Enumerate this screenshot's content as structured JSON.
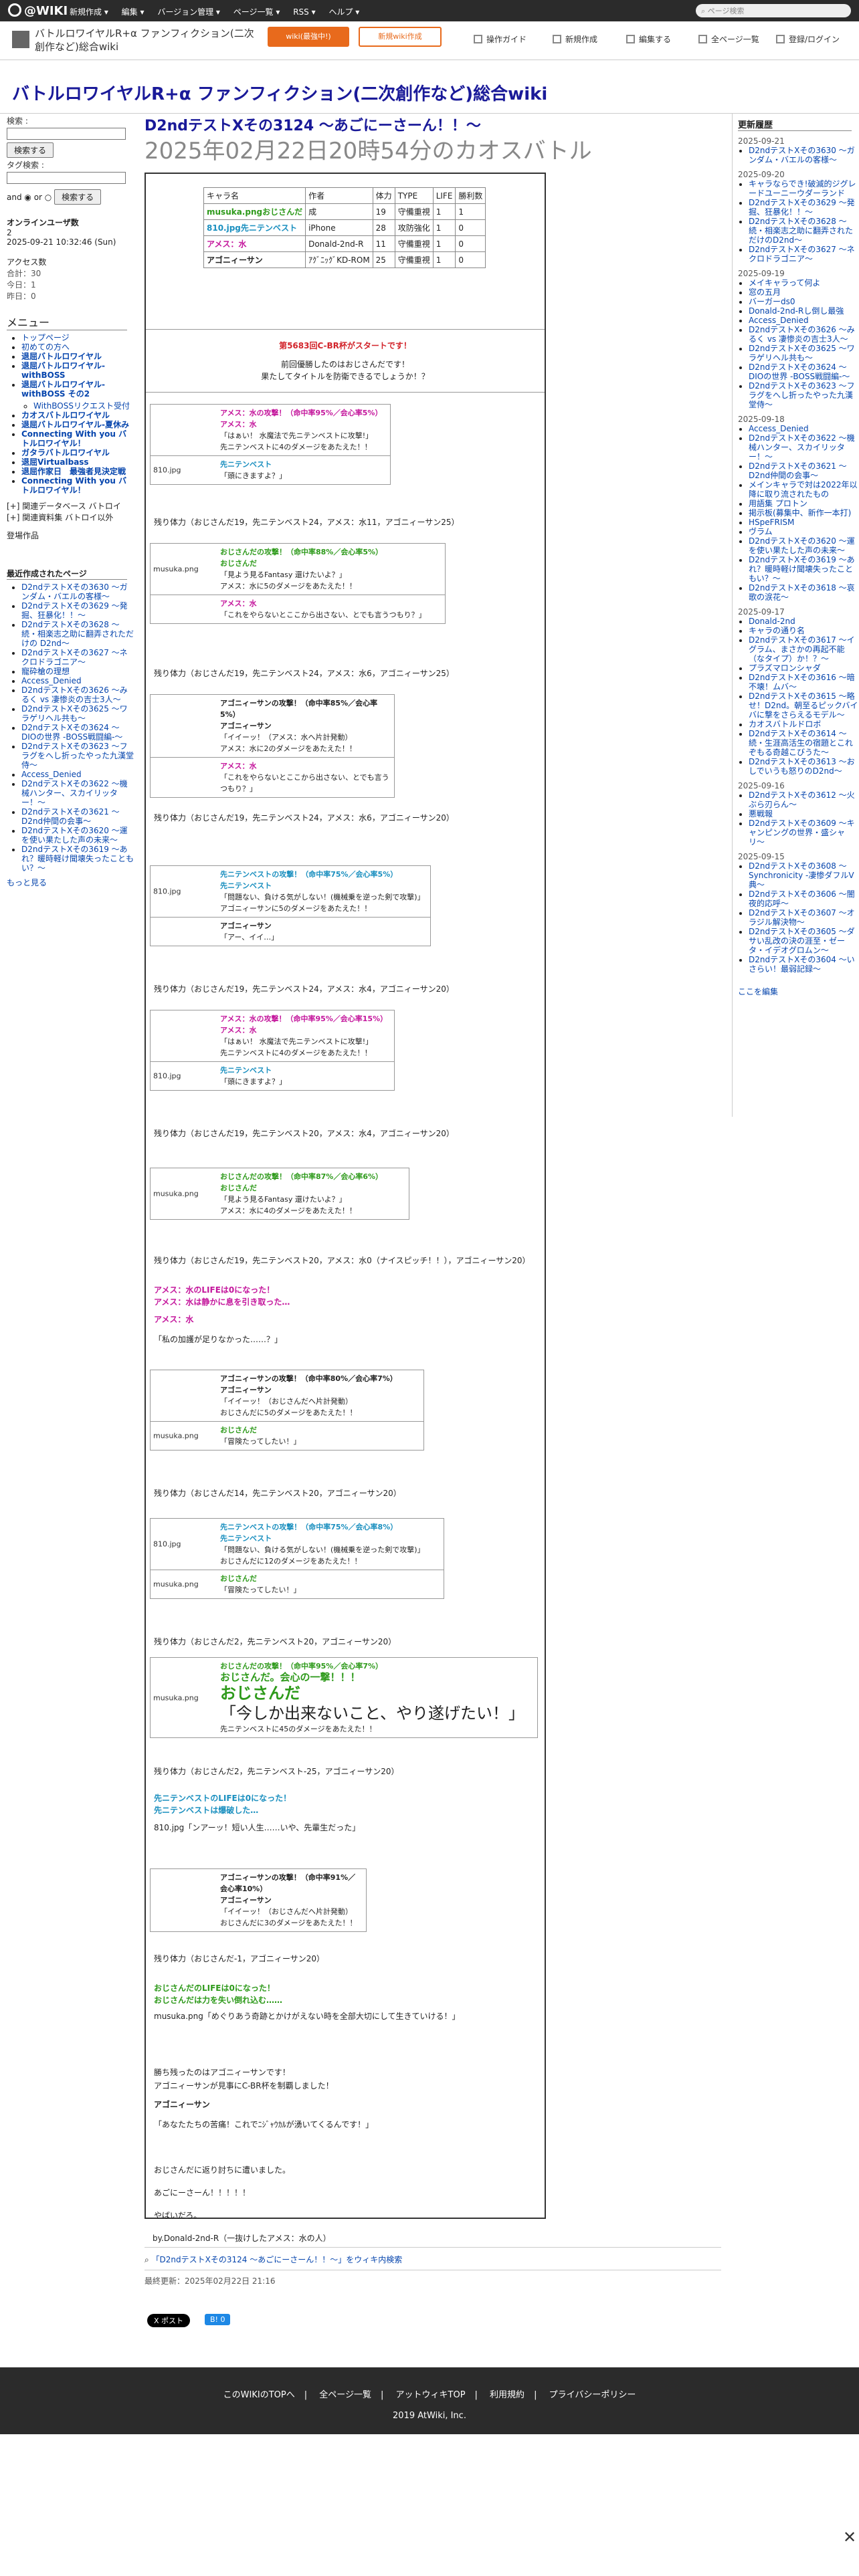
{
  "topbar": {
    "logo": "@WIKI",
    "menu": [
      "新規作成 ▾",
      "編集 ▾",
      "バージョン管理 ▾",
      "ページ一覧 ▾",
      "RSS ▾",
      "ヘルプ ▾"
    ],
    "search": "ページ検索"
  },
  "header": {
    "title": "バトルロワイヤルR+α ファンフィクション(二次創作など)総合wiki",
    "btn1": "wiki(最強中!)",
    "btn2": "新規wiki作成",
    "actions": [
      "操作ガイド",
      "新規作成",
      "編集する",
      "全ページ一覧",
      "登録/ログイン"
    ]
  },
  "banner": {
    "title": "バトルロワイヤルR+α ファンフィクション(二次創作など)総合wiki"
  },
  "left": {
    "search_label": "検索 :",
    "search_btn": "検索する",
    "tag_label": "タグ検索 :",
    "and": "and",
    "or": "or",
    "search_btn2": "検索する",
    "online": "オンラインユーザ数",
    "online_n": "2",
    "time": "2025-09-21 10:32:46 (Sun)",
    "access_hdr": "アクセス数",
    "access": [
      "合計：30",
      "今日：1",
      "昨日：0"
    ],
    "menu_hdr": "メニュー",
    "menu": [
      "トップページ",
      "初めての方へ",
      "退屈バトルロワイヤル",
      "退屈バトルロワイヤル-withBOSS",
      "退屈バトルロワイヤル-withBOSS その2",
      "WithBOSSリクエスト受付",
      "カオスバトルロワイヤル",
      "退屈バトルロワイヤル-夏休み",
      "Connecting With you バトルロワイヤル！",
      "ガタラバトルロワイヤル",
      "退屈Virtualbass",
      "退屈作家日　最強者見決定戦",
      "Connecting With you バトルロワイヤル！"
    ],
    "side2": [
      "関連データベース バトロイ",
      "関連資料集 バトロイ以外"
    ],
    "section_hdr": "登場作品",
    "recent_hdr": "最近作成されたページ",
    "recent": [
      "D2ndテストXその3630 〜ガンダム・バエルの客様〜",
      "D2ndテストXその3629 〜発掘、狂暴化！！〜",
      "D2ndテストXその3628 〜続・相楽志之助に翻弄されただけの D2nd〜",
      "D2ndテストXその3627 〜ネクロドラゴニア〜",
      "寵砕槍の理想",
      "Access_Denied",
      "D2ndテストXその3626 〜みるく vs 凄惨炎の吉士3人〜",
      "D2ndテストXその3625 〜ワラゲリヘル共も〜",
      "D2ndテストXその3624 〜DIOの世界 -BOSS戦闘編-〜",
      "D2ndテストXその3623 〜フラグをへし折ったやった九漢堂侍〜",
      "Access_Denied",
      "D2ndテストXその3622 〜機械ハンター、スカイリッター！〜",
      "D2ndテストXその3621 〜D2nd仲間の会事〜",
      "D2ndテストXその3620 〜運を使い果たした声の未来〜",
      "D2ndテストXその3619 〜あれ？暖時軽け聞壊失ったこともい？〜"
    ],
    "more": "もっと見る"
  },
  "main": {
    "title": "D2ndテストXその3124 〜あごにーさーん！！〜",
    "subtitle": "2025年02月22日20時54分のカオスバトル",
    "ptable": {
      "headers": [
        "キャラ名",
        "作者",
        "体力",
        "TYPE",
        "LIFE",
        "勝利数"
      ],
      "rows": [
        [
          "musuka.pngおじさんだ",
          "成",
          "19",
          "守備重視",
          "1",
          "1"
        ],
        [
          "810.jpg先ニテンベスト",
          "iPhone",
          "28",
          "攻防強化",
          "1",
          "0"
        ],
        [
          "アメス：水",
          "Donald-2nd-R",
          "11",
          "守備重視",
          "1",
          "0"
        ],
        [
          "アゴニィーサン",
          "ｱｸﾞﾆｯｸﾞKD-ROM",
          "25",
          "守備重視",
          "1",
          "0"
        ]
      ]
    },
    "start": [
      "第5683回C-BR杯がスタートです！",
      "前回優勝したのはおじさんだです！",
      "果たしてタイトルを防衛できるでしょうか！？"
    ],
    "status_lines": [
      "残り体力（おじさんだ19，先ニテンベスト24，アメス：水11，アゴニィーサン25）",
      "残り体力（おじさんだ19，先ニテンベスト24，アメス：水6，アゴニィーサン25）",
      "残り体力（おじさんだ19，先ニテンベスト24，アメス：水6，アゴニィーサン20）",
      "残り体力（おじさんだ19，先ニテンベスト24，アメス：水4，アゴニィーサン20）",
      "残り体力（おじさんだ19，先ニテンベスト20，アメス：水4，アゴニィーサン20）",
      "残り体力（おじさんだ19，先ニテンベスト20，アメス：水0（ナイスピッチ！！），アゴニィーサン20）",
      "残り体力（おじさんだ14，先ニテンベスト20，アゴニィーサン20）",
      "残り体力（おじさんだ2，先ニテンベスト20，アゴニィーサン20）",
      "残り体力（おじさんだ2，先ニテンベスト-25，アゴニィーサン20）",
      "残り体力（おじさんだ-1，アゴニィーサン20）"
    ],
    "rounds": [
      [
        [
          "",
          "アメス：水の攻撃！（命中率95%／会心率5%）",
          "アメス：水",
          "「はぁい！ 水魔法で先ニテンベストに攻撃!」",
          "先ニテンベストに4のダメージをあたえた！！"
        ],
        [
          "810.jpg",
          "先ニテンベスト",
          "「頭にきますよ？」"
        ]
      ],
      [
        [
          "musuka.png",
          "おじさんだの攻撃！（命中率88%／会心率5%）",
          "おじさんだ",
          "「見よう見るFantasy 還けたいよ？」",
          "アメス：水に5のダメージをあたえた！！"
        ],
        [
          "",
          "アメス：水",
          "「これをやらないとここから出さない、とでも言うつもり？」"
        ]
      ],
      [
        [
          "",
          "アゴニィーサンの攻撃！（命中率85%／会心率5%）",
          "アゴニィーサン",
          "「イイーッ！（アメス：水へ片計発動）",
          "アメス：水に2のダメージをあたえた！！"
        ],
        [
          "",
          "アメス：水",
          "「これをやらないとここから出さない、とでも言うつもり？」"
        ]
      ],
      [
        [
          "810.jpg",
          "先ニテンベストの攻撃！（命中率75%／会心率5%）",
          "先ニテンベスト",
          "「問題ない、負ける気がしない！(機械乗を逆った剣で攻撃)」",
          "アゴニィーサンに5のダメージをあたえた！！"
        ],
        [
          "",
          "アゴニィーサン",
          "「アー、イイ…」"
        ]
      ],
      [
        [
          "",
          "アメス：水の攻撃！（命中率95%／会心率15%）",
          "アメス：水",
          "「はぁい！ 水魔法で先ニテンベストに攻撃!」",
          "先ニテンベストに4のダメージをあたえた！！"
        ],
        [
          "810.jpg",
          "先ニテンベスト",
          "「頭にきますよ？」"
        ]
      ],
      [
        [
          "musuka.png",
          "おじさんだの攻撃！（命中率87%／会心率6%）",
          "おじさんだ",
          "「見よう見るFantasy 還けたいよ？」",
          "アメス：水に4のダメージをあたえた！！"
        ]
      ],
      [
        [
          "",
          "アゴニィーサンの攻撃！（命中率80%／会心率7%）",
          "アゴニィーサン",
          "「イイーッ！（おじさんだへ片計発動）",
          "おじさんだに5のダメージをあたえた！！"
        ],
        [
          "musuka.png",
          "おじさんだ",
          "「冒険たってしたい！」"
        ]
      ],
      [
        [
          "810.jpg",
          "先ニテンベストの攻撃！（命中率75%／会心率8%）",
          "先ニテンベスト",
          "「問題ない、負ける気がしない！(機械乗を逆った剣で攻撃)」",
          "おじさんだに12のダメージをあたえた！！"
        ],
        [
          "musuka.png",
          "おじさんだ",
          "「冒険たってしたい！」"
        ]
      ],
      [
        [
          "musuka.png",
          "おじさんだの攻撃！（命中率95%／会心率7%）",
          "おじさんだ。会心の一撃！！！",
          "おじさんだ",
          "「今しか出来ないこと、やり遂げたい！」",
          "先ニテンベストに45のダメージをあたえた！！"
        ]
      ],
      [
        [
          "",
          "アゴニィーサンの攻撃！（命中率91%／会心率10%）",
          "アゴニィーサン",
          "「イイーッ！（おじさんだへ片計発動）",
          "おじさんだに3のダメージをあたえた！！"
        ]
      ]
    ],
    "amesu_death": [
      "アメス：水のLIFEは0になった！",
      "アメス：水は静かに息を引き取った…"
    ],
    "amesu_name": "アメス：水",
    "amesu_quote": "「私の加護が足りなかった……？」",
    "sen_death": [
      "先ニテンベストのLIFEは0になった！",
      "先ニテンベストは爆破した…"
    ],
    "sen_quote": "810.jpg「ンアーッ！短い人生……いや、先輩生だった」",
    "oji_death": [
      "おじさんだのLIFEは0になった！",
      "おじさんだは力を失い倒れ込む……"
    ],
    "oji_quote": "musuka.png「めぐりあう奇跡とかけがえない時を全部大切にして生きていける！」",
    "win": "勝ち残ったのはアゴニィーサンです！",
    "win2": "アゴニィーサンが見事にC-BR杯を制覇しました！",
    "win_name": "アゴニィーサン",
    "win_quote": "「あなたたちの苦痛！これでﾆｼﾞｬｳｶﾙが湧いてくるんです！」",
    "end": [
      "おじさんだに返り討ちに遭いました。",
      "あごにーさーん！！！！！",
      "やばいだろ。",
      "by.Donald-2nd-R（一抜けしたアメス：水の人）"
    ],
    "search_link": "「D2ndテストXその3124 〜あごにーさーん！！〜」をウィキ内検索",
    "last_update": "最終更新：2025年02月22日 21:16",
    "share": [
      "X ポスト",
      "B! 0"
    ]
  },
  "right": {
    "hdr": "更新履歴",
    "groups": [
      {
        "date": "2025-09-21",
        "items": [
          "D2ndテストXその3630 〜ガンダム・バエルの客様〜"
        ]
      },
      {
        "date": "2025-09-20",
        "items": [
          "キャラならでき!破滅的ジグレードユーニーウダーランド",
          "D2ndテストXその3629 〜発掘、狂暴化！！〜",
          "D2ndテストXその3628 〜続・相楽志之助に翻弄されただけのD2nd〜",
          "D2ndテストXその3627 〜ネクロドラゴニア〜"
        ]
      },
      {
        "date": "2025-09-19",
        "items": [
          "メイキャラって何よ",
          "窓の五月",
          "バーガーds0",
          "Donald-2nd-Rし倒し最強",
          "Access_Denied",
          "D2ndテストXその3626 〜みるく vs 凄惨炎の吉士3人〜",
          "D2ndテストXその3625 〜ワラゲリヘル共も〜",
          "D2ndテストXその3624 〜DIOの世界 -BOSS戦闘編-〜",
          "D2ndテストXその3623 〜フラグをへし折ったやった九漢堂侍〜"
        ]
      },
      {
        "date": "2025-09-18",
        "items": [
          "Access_Denied",
          "D2ndテストXその3622 〜機械ハンター、スカイリッター！〜",
          "D2ndテストXその3621 〜D2nd仲間の会事〜",
          "メインキャラで対は2022年以降に取り流されたもの",
          "用語集 プロトン",
          "掲示板(募集中、新作一本打)",
          "HSpeFRISM",
          "ヴラム",
          "D2ndテストXその3620 〜運を使い果たした声の未来〜",
          "D2ndテストXその3619 〜あれ？暖時軽け聞壊失ったこともい？〜",
          "D2ndテストXその3618 〜哀歌の涙花〜"
        ]
      },
      {
        "date": "2025-09-17",
        "items": [
          "Donald-2nd",
          "キャラの通り名",
          "D2ndテストXその3617 〜イグラム、まさかの再起不能（なタイプ）か！？〜",
          "プラズマロンシャダ",
          "D2ndテストXその3616 〜暗不壊！ムバ〜",
          "D2ndテストXその3615 〜略せ！D2nd。朝至るピックバイバに撃をさらえるモデル〜",
          "カオスバトルドロボ",
          "D2ndテストXその3614 〜続・生涯高活生の宿題とこれぞもる奇越こびうた〜",
          "D2ndテストXその3613 〜おしでいうも怒りのD2nd〜"
        ]
      },
      {
        "date": "2025-09-16",
        "items": [
          "D2ndテストXその3612 〜火ぶら刃らん〜",
          "悪戦報",
          "D2ndテストXその3609 〜キャンピングの世界・盛シャリ〜"
        ]
      },
      {
        "date": "2025-09-15",
        "items": [
          "D2ndテストXその3608 〜Synchronicity -凄惨ダフルV典〜",
          "D2ndテストXその3606 〜闇夜的応呼〜",
          "D2ndテストXその3607 〜オラジル解決物〜",
          "D2ndテストXその3605 〜ダサい乱改の決の涯至・ゼータ・イデオグロムン〜",
          "D2ndテストXその3604 〜いさらい！最弱記録〜"
        ]
      }
    ],
    "edit": "ここを編集"
  },
  "footer": {
    "links": [
      "このWIKIのTOPへ",
      "全ページ一覧",
      "アットウィキTOP",
      "利用規約",
      "プライバシーポリシー"
    ],
    "copy": "2019 AtWiki, Inc."
  }
}
